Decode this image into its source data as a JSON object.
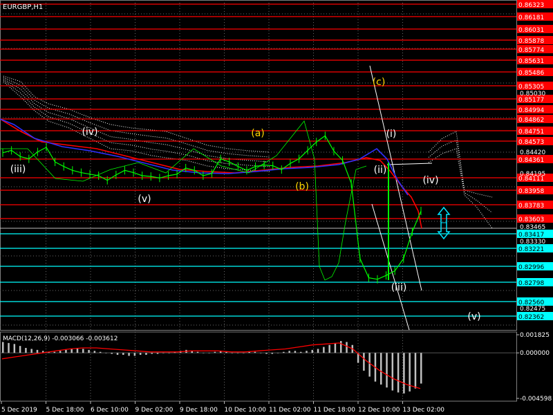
{
  "symbol": "EURGBP,H1",
  "macd_label": "MACD(12,26,9) -0.003066 -0.003612",
  "colors": {
    "background": "#000000",
    "resistance": "#ff0000",
    "support": "#00ffff",
    "price_line": "#00ff00",
    "ma_red": "#ff0000",
    "ma_blue": "#3030ff",
    "ichimoku": "#ffffff",
    "wave_label_yellow": "#ffd700",
    "wave_label_white": "#ffffff",
    "arrow": "#00e5ff",
    "grid": "#6b6b6b"
  },
  "chart_data": {
    "type": "line",
    "title": "EURGBP,H1",
    "y_axis": {
      "red_levels": [
        "0.86323",
        "0.86181",
        "0.86031",
        "0.85878",
        "0.85774",
        "0.85631",
        "0.85486",
        "0.85305",
        "0.85177",
        "0.84994",
        "0.84862",
        "0.84751",
        "0.84573",
        "0.84361",
        "0.84111",
        "0.83958",
        "0.83783",
        "0.83603"
      ],
      "cyan_levels": [
        "0.83417",
        "0.83221",
        "0.82996",
        "0.82798",
        "0.82560",
        "0.82362"
      ],
      "plain_ticks": [
        "0.85030",
        "0.84420",
        "0.84195",
        "0.83465",
        "0.83330",
        "0.82475"
      ],
      "range": [
        0.8217,
        0.8647
      ]
    },
    "x_axis": {
      "ticks": [
        "5 Dec 2019",
        "5 Dec 18:00",
        "6 Dec 10:00",
        "9 Dec 02:00",
        "9 Dec 18:00",
        "10 Dec 10:00",
        "11 Dec 02:00",
        "11 Dec 18:00",
        "12 Dec 10:00",
        "13 Dec 02:00"
      ]
    },
    "wave_labels": [
      {
        "text": "(iii)",
        "color": "white"
      },
      {
        "text": "(iv)",
        "color": "white"
      },
      {
        "text": "(v)",
        "color": "white"
      },
      {
        "text": "(a)",
        "color": "yellow"
      },
      {
        "text": "(b)",
        "color": "yellow"
      },
      {
        "text": "(c)",
        "color": "yellow"
      },
      {
        "text": "(i)",
        "color": "white"
      },
      {
        "text": "(ii)",
        "color": "white"
      },
      {
        "text": "(iii)",
        "color": "white"
      },
      {
        "text": "(iv)",
        "color": "white"
      },
      {
        "text": "(v)",
        "color": "white"
      }
    ],
    "price_series": {
      "name": "",
      "values": [
        0.8448,
        0.8451,
        0.8443,
        0.844,
        0.8449,
        0.8455,
        0.8436,
        0.843,
        0.8425,
        0.8422,
        0.842,
        0.8418,
        0.8412,
        0.8419,
        0.8425,
        0.8422,
        0.8418,
        0.8417,
        0.8415,
        0.8418,
        0.842,
        0.8428,
        0.8425,
        0.8418,
        0.8421,
        0.844,
        0.8436,
        0.843,
        0.8425,
        0.843,
        0.8432,
        0.8431,
        0.8426,
        0.8434,
        0.844,
        0.8451,
        0.8462,
        0.847,
        0.845,
        0.8438,
        0.8408,
        0.831,
        0.8285,
        0.8283,
        0.8288,
        0.8294,
        0.831,
        0.8345,
        0.8372
      ]
    },
    "macd": {
      "ticks": [
        "0.001825",
        "0.000000",
        "-0.004598"
      ],
      "range": [
        -0.0046,
        0.00183
      ],
      "histogram": [
        0.0011,
        0.001,
        0.0009,
        0.0007,
        0.0005,
        0.0004,
        0.0003,
        0.0002,
        0.0001,
        0.0001,
        0.0002,
        0.0003,
        0.0004,
        0.0005,
        0.0004,
        0.0003,
        0.0002,
        0.0001,
        0.0,
        -0.0001,
        -0.0002,
        -0.0002,
        -0.0003,
        -0.0003,
        -0.0002,
        -0.0002,
        -0.0001,
        -0.0001,
        0.0,
        0.0,
        0.0001,
        0.0002,
        0.0003,
        0.0002,
        0.0001,
        0.0,
        0.0,
        0.0001,
        0.0002,
        0.0001,
        0.0,
        0.0,
        0.0,
        0.0001,
        0.0001,
        0.0,
        -0.0001,
        -0.0001,
        0.0,
        0.0001,
        0.0002,
        0.0002,
        0.0001,
        0.0002,
        0.0003,
        0.0004,
        0.0006,
        0.0008,
        0.001,
        0.0012,
        0.0011,
        0.0008,
        -0.001,
        -0.0018,
        -0.0024,
        -0.0029,
        -0.0032,
        -0.0035,
        -0.0038,
        -0.004,
        -0.0041,
        -0.0039,
        -0.0036,
        -0.0031
      ],
      "signal": [
        -0.0006,
        -0.0004,
        -0.0002,
        0.0,
        0.0002,
        0.0004,
        0.0005,
        0.0005,
        0.0004,
        0.0003,
        0.0002,
        0.0001,
        0.0001,
        0.0001,
        0.0002,
        0.0002,
        0.0002,
        0.0001,
        0.0001,
        0.0002,
        0.0003,
        0.0004,
        0.0006,
        0.0008,
        0.0009,
        0.001,
        0.0004,
        -0.0008,
        -0.0018,
        -0.0026,
        -0.0032,
        -0.0036
      ]
    }
  }
}
